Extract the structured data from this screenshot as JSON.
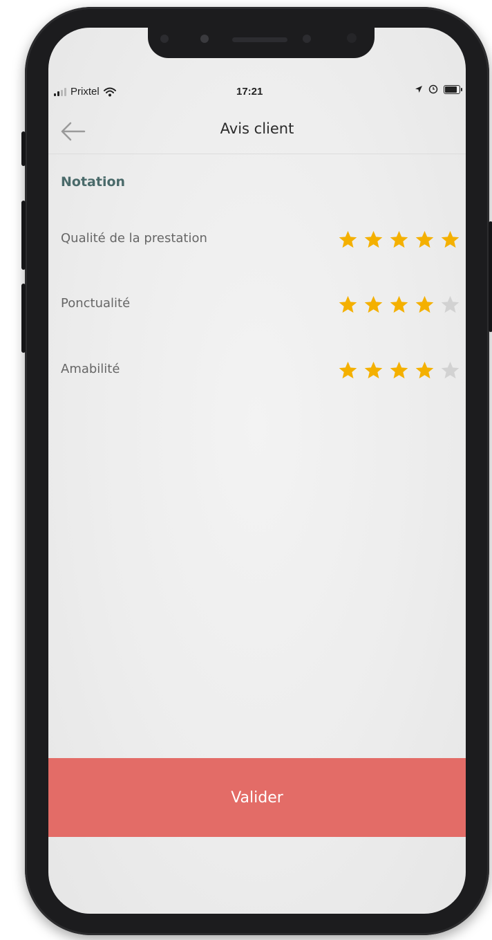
{
  "status_bar": {
    "carrier": "Prixtel",
    "time": "17:21",
    "signal_bars": 4,
    "signal_bars_filled": 2
  },
  "header": {
    "title": "Avis client",
    "back_icon": "arrow-left-icon"
  },
  "section": {
    "title": "Notation"
  },
  "ratings": [
    {
      "label": "Qualité de la prestation",
      "value": 5,
      "max": 5
    },
    {
      "label": "Ponctualité",
      "value": 4,
      "max": 5
    },
    {
      "label": "Amabilité",
      "value": 4,
      "max": 5
    }
  ],
  "submit": {
    "label": "Valider"
  },
  "colors": {
    "star_filled": "#f4b000",
    "star_empty": "#d2d2d2",
    "submit_button": "#e36c67",
    "section_title": "#4a6a6a"
  }
}
